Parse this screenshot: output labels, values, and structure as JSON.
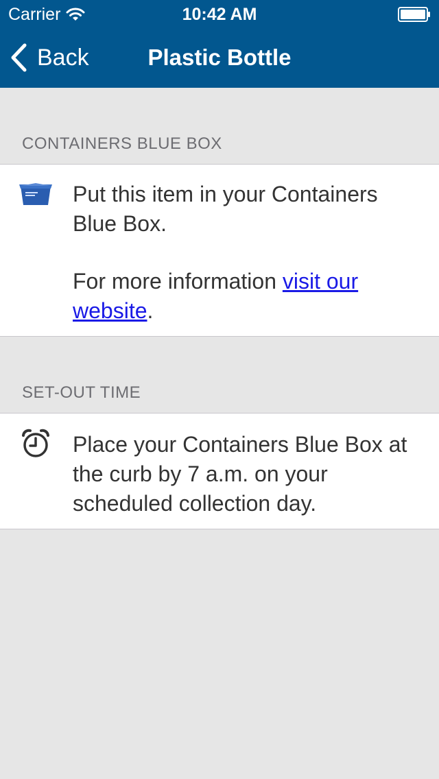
{
  "status_bar": {
    "carrier": "Carrier",
    "time": "10:42 AM",
    "wifi_icon": "wifi-icon",
    "battery_icon": "battery-icon"
  },
  "nav": {
    "back_label": "Back",
    "title": "Plastic Bottle",
    "bar_color": "#02578f"
  },
  "sections": [
    {
      "header": "CONTAINERS BLUE BOX",
      "icon": "blue-box-icon",
      "text": "Put this item in your Containers Blue Box.",
      "more_prefix": "For more information ",
      "link_text": "visit our website",
      "more_suffix": "."
    },
    {
      "header": "SET-OUT TIME",
      "icon": "alarm-clock-icon",
      "text": "Place your Containers Blue Box at the curb by 7 a.m. on your scheduled collection day."
    }
  ]
}
